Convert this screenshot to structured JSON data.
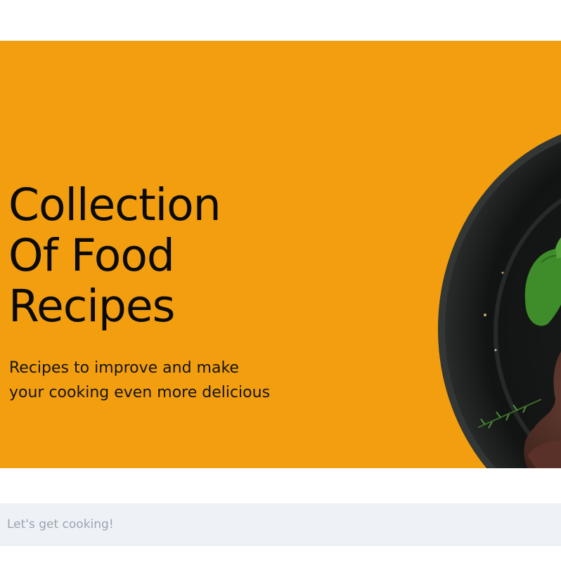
{
  "hero": {
    "title_lines": [
      "Collection",
      "Of Food",
      "Recipes"
    ],
    "subtitle_lines": [
      "Recipes to improve and make",
      "your cooking even more delicious"
    ],
    "background_color": "#f39e0f",
    "image": "food-plate-image"
  },
  "search": {
    "placeholder": "Let's get cooking!",
    "value": ""
  }
}
